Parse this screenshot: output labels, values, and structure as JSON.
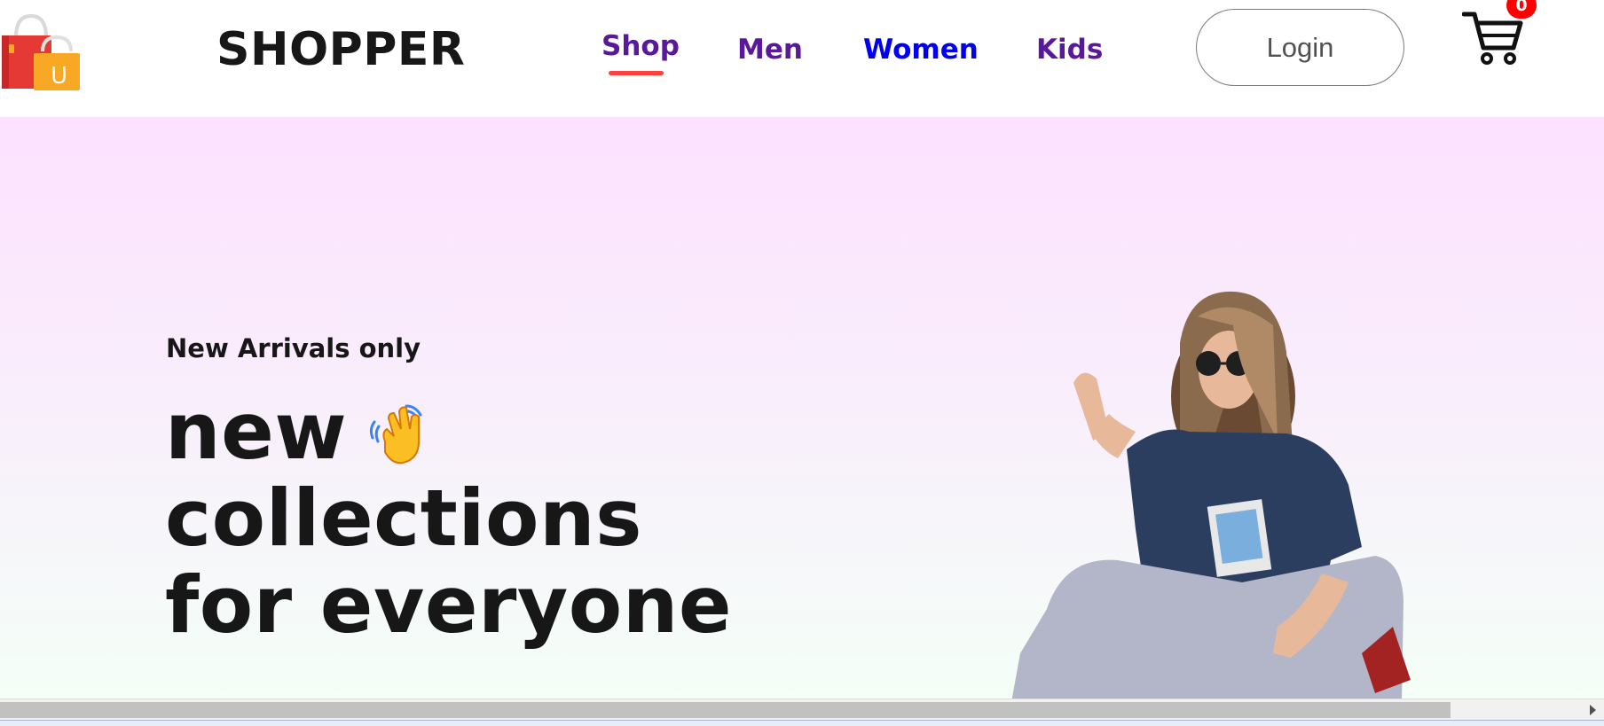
{
  "header": {
    "logo_icon": "shopping-bag-icon",
    "logo_letter": "U",
    "brand": "SHOPPER",
    "nav": [
      "Shop",
      "Men",
      "Women",
      "Kids"
    ],
    "active_nav": "Shop",
    "login_label": "Login",
    "cart_icon": "cart-icon",
    "cart_count": "0"
  },
  "hero": {
    "subtitle": "New Arrivals only",
    "title_line1": "new",
    "title_line2": "collections",
    "title_line3": "for everyone",
    "hand_icon": "waving-hand-icon"
  },
  "colors": {
    "brand_text": "#171717",
    "nav_visited": "#5a189a",
    "nav_link": "#0000ee",
    "accent": "#ff4141",
    "badge": "#ff0000",
    "hero_gradient_top": "#fde1ff",
    "hero_gradient_bottom": "#f4fff7"
  }
}
